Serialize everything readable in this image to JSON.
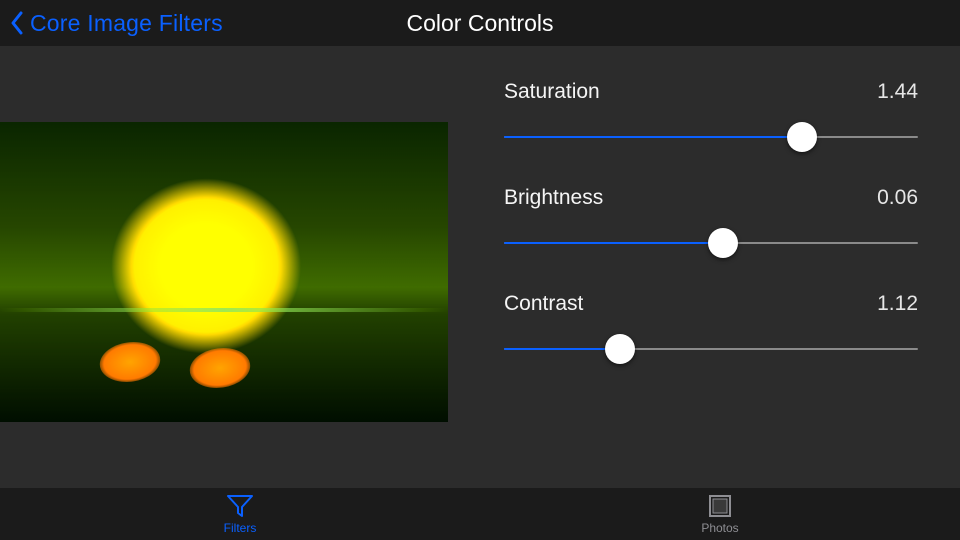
{
  "colors": {
    "accent": "#0a60ff",
    "bg_content": "#2c2c2c",
    "bg_bars": "#1b1b1b",
    "text_light": "#f5f5f5",
    "text_muted": "#8e8e93"
  },
  "nav": {
    "back_label": "Core Image Filters",
    "title": "Color Controls"
  },
  "preview": {
    "subject": "duckling-photo"
  },
  "params": [
    {
      "label": "Saturation",
      "value": "1.44",
      "fraction": 0.72
    },
    {
      "label": "Brightness",
      "value": "0.06",
      "fraction": 0.53
    },
    {
      "label": "Contrast",
      "value": "1.12",
      "fraction": 0.28
    }
  ],
  "tabs": [
    {
      "icon": "filter-icon",
      "label": "Filters",
      "active": true
    },
    {
      "icon": "photos-icon",
      "label": "Photos",
      "active": false
    }
  ]
}
